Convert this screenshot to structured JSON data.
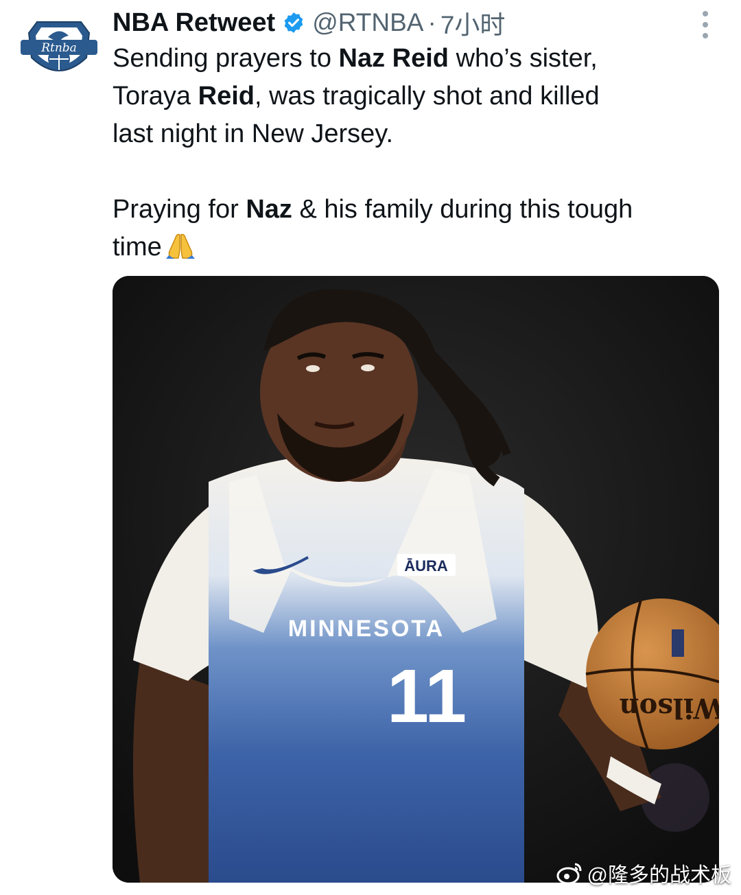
{
  "tweet": {
    "display_name": "NBA Retweet",
    "handle": "@RTNBA",
    "separator": "·",
    "time": "7小时",
    "avatar_text": "Rtnba",
    "verified_icon": "verified-badge-icon",
    "more_icon": "more-vertical-icon",
    "body": {
      "l1_a": "Sending prayers to ",
      "l1_b": "Naz Reid",
      "l1_c": " who’s sister,",
      "l2_a": "Toraya ",
      "l2_b": "Reid",
      "l2_c": ", was tragically shot and killed",
      "l3": "last night in New Jersey.",
      "l4_a": "Praying for ",
      "l4_b": "Naz",
      "l4_c": " & his family during this tough",
      "l5": "time"
    }
  },
  "media": {
    "jersey_sponsor": "ĀURA",
    "jersey_team": "MINNESOTA",
    "jersey_number": "11",
    "ball_brand": "Wilson"
  },
  "watermark": {
    "text": "@隆多的战术板",
    "icon": "weibo-icon"
  },
  "colors": {
    "text": "#0f1419",
    "secondary": "#536471",
    "verified": "#1d9bf0",
    "jersey_blue": "#2f5597"
  }
}
